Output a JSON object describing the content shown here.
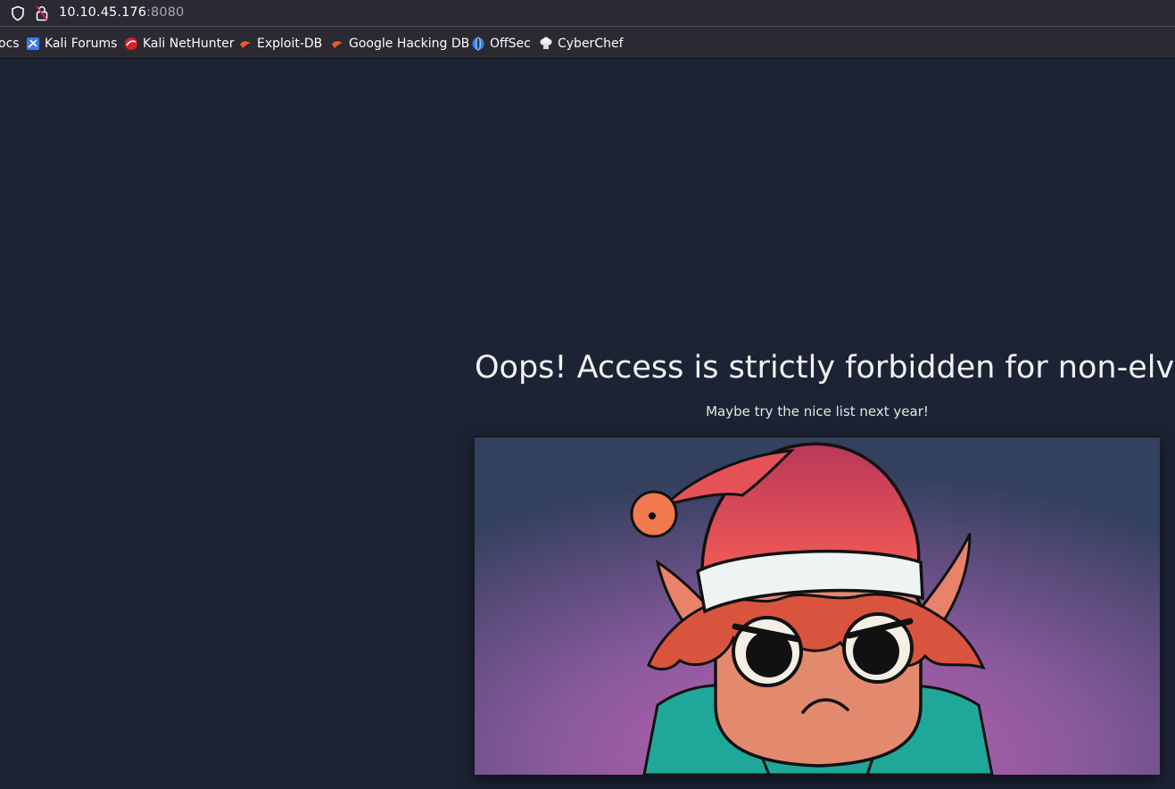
{
  "browser": {
    "url_host": "10.10.45.176",
    "url_port": ":8080",
    "bookmarks": [
      {
        "label": "ocs",
        "icon": "docs-icon"
      },
      {
        "label": "Kali Forums",
        "icon": "kali-forums-icon"
      },
      {
        "label": "Kali NetHunter",
        "icon": "kali-nethunter-icon"
      },
      {
        "label": "Exploit-DB",
        "icon": "exploit-db-icon"
      },
      {
        "label": "Google Hacking DB",
        "icon": "exploit-db-icon"
      },
      {
        "label": "OffSec",
        "icon": "offsec-icon"
      },
      {
        "label": "CyberChef",
        "icon": "cyberchef-icon"
      }
    ]
  },
  "page": {
    "title": "Oops! Access is strictly forbidden for non-elves.",
    "subtitle": "Maybe try the nice list next year!",
    "image": "angry-elf-illustration"
  },
  "colors": {
    "page_background": "#1c2334",
    "browser_chrome": "#2b2a33",
    "hat_red": "#e8545a",
    "coat_teal": "#1fa89a"
  }
}
